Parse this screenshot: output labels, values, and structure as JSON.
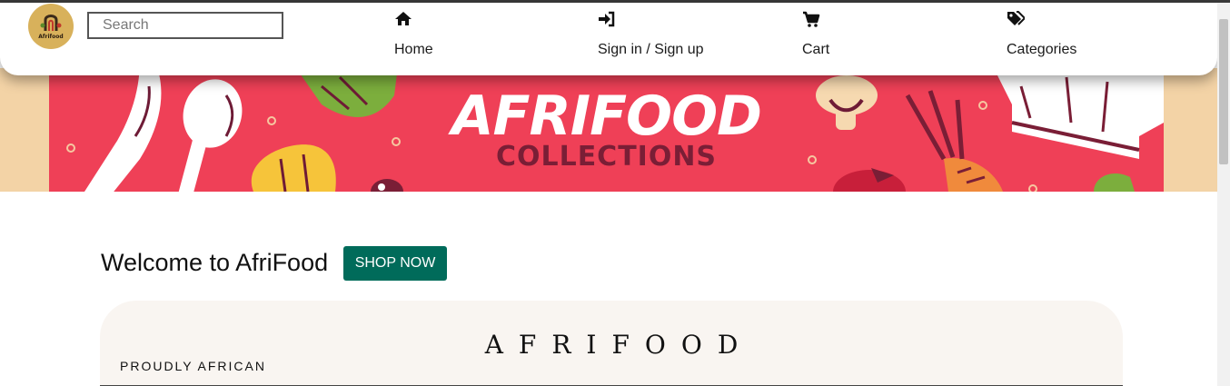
{
  "logo": {
    "text": "Afrifood"
  },
  "search": {
    "placeholder": "Search"
  },
  "nav": {
    "items": [
      {
        "label": "Home",
        "icon": "home-icon"
      },
      {
        "label": "Sign in / Sign up",
        "icon": "sign-in-icon"
      },
      {
        "label": "Cart",
        "icon": "cart-icon"
      },
      {
        "label": "Categories",
        "icon": "tags-icon"
      }
    ]
  },
  "banner": {
    "title": "AFRIFOOD",
    "subtitle": "COLLECTIONS"
  },
  "main": {
    "welcome": "Welcome to AfriFood",
    "shop_now": "SHOP NOW"
  },
  "brand": {
    "logo_text": "AFRIFOOD",
    "tagline": "PROUDLY AFRICAN"
  },
  "colors": {
    "banner_red": "#ef4057",
    "banner_side": "#f3d3a6",
    "button_green": "#006b5a",
    "logo_gold": "#d8b15b",
    "panel_cream": "#f9f5f1"
  }
}
